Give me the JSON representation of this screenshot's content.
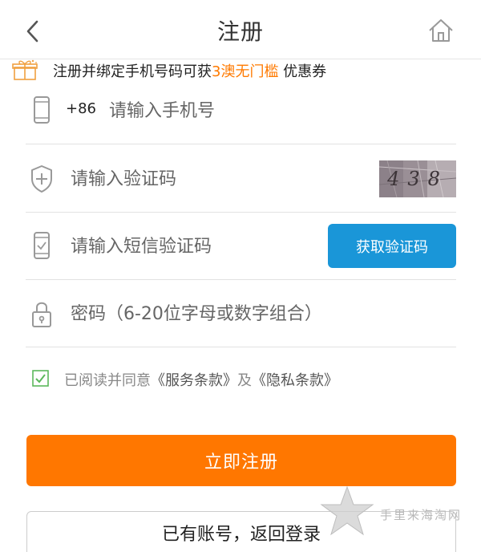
{
  "header": {
    "title": "注册",
    "back_icon": "chevron-left-icon",
    "home_icon": "home-icon"
  },
  "promo": {
    "icon": "gift-icon",
    "text_before": "注册并绑定手机号码可获",
    "highlight": "3澳无门槛",
    "text_after": " 优惠券",
    "highlight_color": "#ff7a00"
  },
  "form": {
    "phone": {
      "icon": "phone-icon",
      "country_code": "+86",
      "placeholder": "请输入手机号"
    },
    "captcha": {
      "icon": "shield-plus-icon",
      "placeholder": "请输入验证码",
      "image_text": "438"
    },
    "sms": {
      "icon": "phone-check-icon",
      "placeholder": "请输入短信验证码",
      "button_label": "获取验证码",
      "button_color": "#1a96d8"
    },
    "password": {
      "icon": "lock-icon",
      "placeholder": "密码（6-20位字母或数字组合）"
    }
  },
  "agreement": {
    "checked": true,
    "text_before": "已阅读并同意",
    "terms_link": "《服务条款》",
    "middle": "及",
    "privacy_link": "《隐私条款》"
  },
  "actions": {
    "register_label": "立即注册",
    "register_color": "#ff7700",
    "login_label": "已有账号，返回登录"
  },
  "watermark": {
    "icon": "star-icon",
    "text": "手里来海淘网"
  }
}
